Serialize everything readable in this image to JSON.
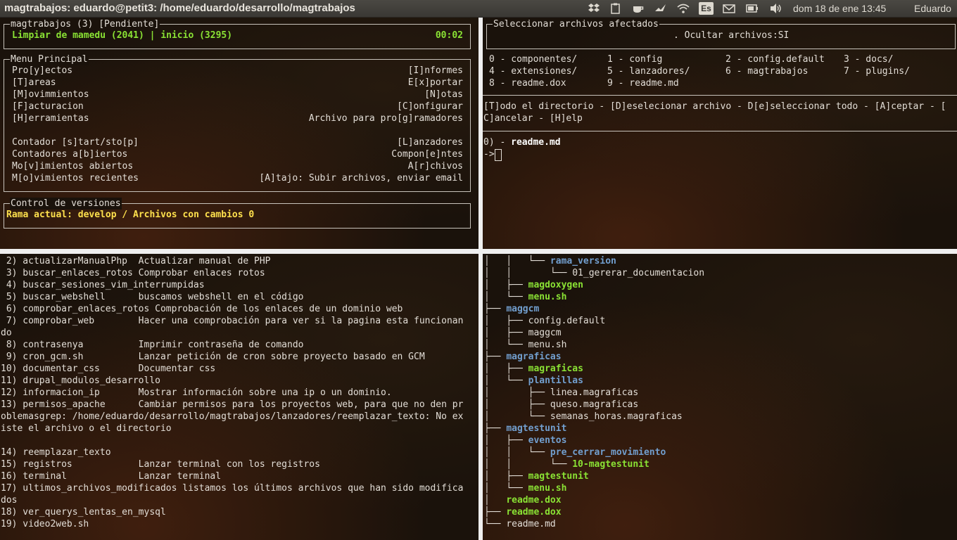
{
  "topbar": {
    "window_title": "magtrabajos: eduardo@petit3: /home/eduardo/desarrollo/magtrabajos",
    "tray_icons": [
      "dropbox-icon",
      "clipboard-icon",
      "coffee-cup-icon",
      "bird-notification-icon",
      "wifi-icon",
      "keyboard-layout-icon",
      "mail-icon",
      "battery-icon",
      "volume-icon"
    ],
    "keyboard_layout": "Es",
    "clock": "dom 18 de ene 13:45",
    "user": "Eduardo"
  },
  "top_left": {
    "status_box": {
      "title": "magtrabajos (3) [Pendiente]",
      "task": "Limpiar de mamedu (2041) | inicio (3295)",
      "timer": "00:02"
    },
    "menu": {
      "title": "Menu Principal",
      "left_items": [
        "Pro[y]ectos",
        "[T]areas",
        "[M]ovimmientos",
        "[F]acturacion",
        "[H]erramientas",
        "",
        "Contador [s]tart/sto[p]",
        "Contadores a[b]iertos",
        "Mo[v]imientos abiertos",
        "M[o]vimientos recientes"
      ],
      "right_items": [
        "[I]nformes",
        "E[x]portar",
        "[N]otas",
        "[C]onfigurar",
        "Archivo para pro[g]ramadores",
        "",
        "[L]anzadores",
        "Compon[e]ntes",
        "A[r]chivos",
        "[A]tajo: Subir archivos, enviar email"
      ]
    },
    "vcs": {
      "title": "Control de versiones",
      "status": "Rama actual: develop / Archivos con cambios 0"
    }
  },
  "top_right": {
    "box_title": "Seleccionar archivos afectados",
    "hidden_files": ". Ocultar archivos:SI",
    "file_rows": [
      [
        "0 - componentes/",
        "1 - config",
        "2 - config.default",
        "3 - docs/"
      ],
      [
        "4 - extensiones/",
        "5 - lanzadores/",
        "6 - magtrabajos",
        "7 - plugins/"
      ],
      [
        "8 - readme.dox",
        "9 - readme.md"
      ]
    ],
    "actions_line1": "[T]odo el directorio - [D]eselecionar archivo - D[e]seleccionar todo - [A]ceptar - [",
    "actions_line2": "C]ancelar - [H]elp",
    "selected_prefix": "0) - ",
    "selected_file": "readme.md",
    "prompt": "->"
  },
  "bottom_left": {
    "lines": [
      " 2) actualizarManualPhp  Actualizar manual de PHP",
      " 3) buscar_enlaces_rotos Comprobar enlaces rotos",
      " 4) buscar_sesiones_vim_interrumpidas",
      " 5) buscar_webshell      buscamos webshell en el código",
      " 6) comprobar_enlaces_rotos Comprobación de los enlaces de un dominio web",
      " 7) comprobar_web        Hacer una comprobación para ver si la pagina esta funcionan",
      "do",
      " 8) contrasenya          Imprimir contraseña de comando",
      " 9) cron_gcm.sh          Lanzar petición de cron sobre proyecto basado en GCM",
      "10) documentar_css       Documentar css",
      "11) drupal_modulos_desarrollo",
      "12) informacion_ip       Mostrar información sobre una ip o un dominio.",
      "13) permisos_apache      Cambiar permisos para los proyectos web, para que no den pr",
      "oblemasgrep: /home/eduardo/desarrollo/magtrabajos/lanzadores/reemplazar_texto: No ex",
      "iste el archivo o el directorio",
      "",
      "14) reemplazar_texto",
      "15) registros            Lanzar terminal con los registros",
      "16) terminal             Lanzar terminal",
      "17) ultimos_archivos_modificados listamos los últimos archivos que han sido modifica",
      "dos",
      "18) ver_querys_lentas_en_mysql",
      "19) video2web.sh"
    ]
  },
  "bottom_right": {
    "tree": [
      {
        "prefix": "│   │   └── ",
        "name": "rama_version",
        "style": "dir"
      },
      {
        "prefix": "│   │       └── ",
        "name": "01_gererar_documentacion",
        "style": "file"
      },
      {
        "prefix": "│   ├── ",
        "name": "magdoxygen",
        "style": "exec"
      },
      {
        "prefix": "│   └── ",
        "name": "menu.sh",
        "style": "exec"
      },
      {
        "prefix": "├── ",
        "name": "maggcm",
        "style": "dir"
      },
      {
        "prefix": "│   ├── ",
        "name": "config.default",
        "style": "file"
      },
      {
        "prefix": "│   ├── ",
        "name": "maggcm",
        "style": "file"
      },
      {
        "prefix": "│   └── ",
        "name": "menu.sh",
        "style": "file"
      },
      {
        "prefix": "├── ",
        "name": "magraficas",
        "style": "dir"
      },
      {
        "prefix": "│   ├── ",
        "name": "magraficas",
        "style": "exec"
      },
      {
        "prefix": "│   └── ",
        "name": "plantillas",
        "style": "dir"
      },
      {
        "prefix": "│       ├── ",
        "name": "linea.magraficas",
        "style": "file"
      },
      {
        "prefix": "│       ├── ",
        "name": "queso.magraficas",
        "style": "file"
      },
      {
        "prefix": "│       └── ",
        "name": "semanas_horas.magraficas",
        "style": "file"
      },
      {
        "prefix": "├── ",
        "name": "magtestunit",
        "style": "dir"
      },
      {
        "prefix": "│   ├── ",
        "name": "eventos",
        "style": "dir"
      },
      {
        "prefix": "│   │   └── ",
        "name": "pre_cerrar_movimiento",
        "style": "dir"
      },
      {
        "prefix": "│   │       └── ",
        "name": "10-magtestunit",
        "style": "exec"
      },
      {
        "prefix": "│   ├── ",
        "name": "magtestunit",
        "style": "exec"
      },
      {
        "prefix": "│   └── ",
        "name": "menu.sh",
        "style": "exec"
      },
      {
        "prefix": "│   ",
        "name": "readme.dox",
        "style": "exec"
      },
      {
        "prefix": "├── ",
        "name": "readme.dox",
        "style": "exec"
      },
      {
        "prefix": "└── ",
        "name": "readme.md",
        "style": "file"
      }
    ]
  }
}
